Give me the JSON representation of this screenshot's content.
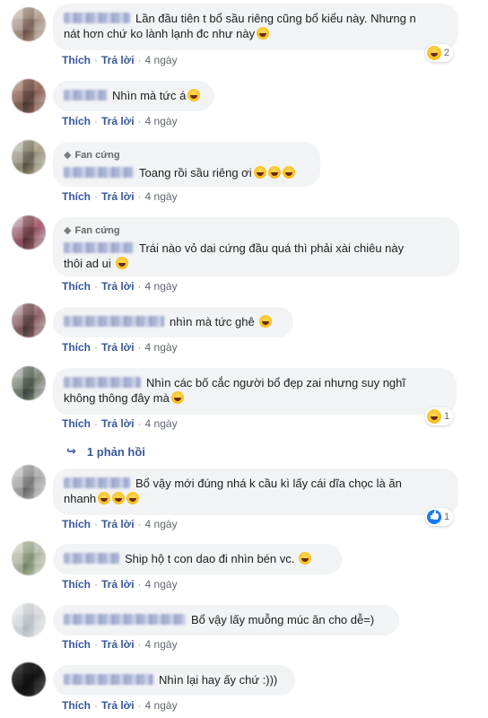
{
  "actions": {
    "like": "Thích",
    "reply": "Trả lời",
    "separator": "·"
  },
  "fan_badge": {
    "icon": "diamond-icon",
    "label": "Fan cứng"
  },
  "comments": [
    {
      "line1": "Lần đầu tiên t bổ sầu riêng cũng bổ kiểu này. Nhưng n",
      "line2": "nát hơn chứ ko lành lạnh đc như này",
      "time": "4 ngày",
      "reaction_count": "2"
    },
    {
      "text": "Nhìn mà tức á",
      "time": "4 ngày"
    },
    {
      "text": "Toang rồi sầu riêng ơi",
      "time": "4 ngày"
    },
    {
      "line1": "Trái nào vỏ dai cứng đầu quá thì phải xài chiêu này",
      "line2": "thôi ad ui",
      "time": "4 ngày"
    },
    {
      "text": "nhìn mà tức ghê",
      "time": "4 ngày"
    },
    {
      "line1": "Nhìn các bố cắc người bổ đẹp zai nhưng suy nghĩ",
      "line2": "không thông đây mà",
      "time": "4 ngày",
      "reaction_count": "1"
    },
    {
      "line1": "Bổ vậy mới đúng nhá k cầu kì lấy cái dĩa chọc là ăn",
      "line2": "nhanh",
      "time": "4 ngày",
      "reaction_count": "1"
    },
    {
      "text": "Ship hộ t con dao đi nhìn bén vc.",
      "time": "4 ngày"
    },
    {
      "text": "Bổ vậy lấy muỗng múc ăn cho dễ=)",
      "time": "4 ngày"
    },
    {
      "text": "Nhìn lại hay ấy chứ :)))",
      "time": "4 ngày"
    }
  ],
  "replies_link": "1 phản hồi"
}
